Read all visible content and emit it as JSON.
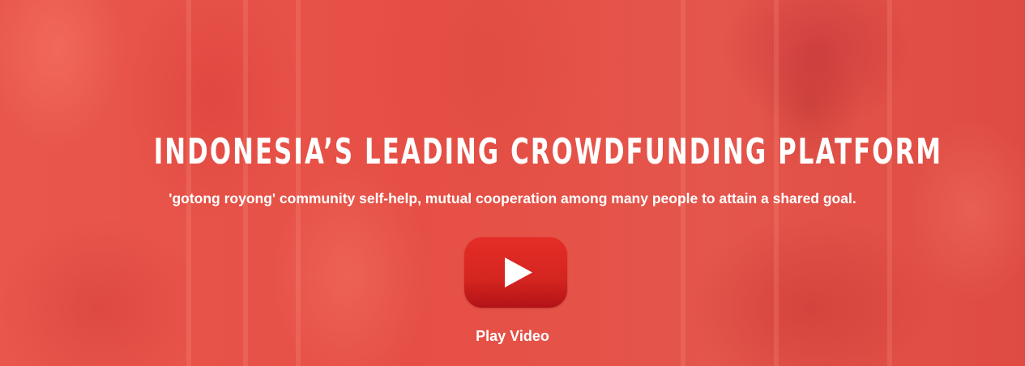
{
  "hero": {
    "title": "INDONESIA’S LEADING CROWDFUNDING PLATFORM",
    "subtitle": "'gotong royong' community self-help, mutual cooperation among many people to attain a shared goal.",
    "play_icon": "youtube-play-icon",
    "play_label": "Play Video"
  },
  "colors": {
    "background_overlay": "#e85248",
    "play_button": "#e52d27",
    "text": "#ffffff"
  }
}
